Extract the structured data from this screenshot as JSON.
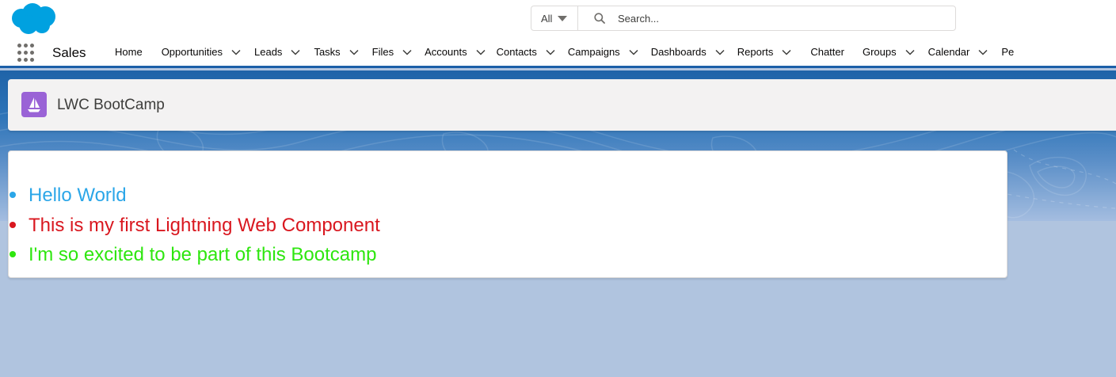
{
  "colors": {
    "brand_cloud": "#00a1e0",
    "nav_underline": "#1b5fa8",
    "page_icon_bg": "#9a63d6",
    "msg1": "#2ba6e8",
    "msg2": "#d9171f",
    "msg3": "#2ee60f"
  },
  "global_header": {
    "logo_icon": "salesforce-cloud-icon",
    "search": {
      "scope_label": "All",
      "placeholder": "Search..."
    }
  },
  "nav": {
    "launcher_icon": "app-launcher-grid-icon",
    "app_name": "Sales",
    "items": [
      {
        "label": "Home",
        "has_menu": false
      },
      {
        "label": "Opportunities",
        "has_menu": true
      },
      {
        "label": "Leads",
        "has_menu": true
      },
      {
        "label": "Tasks",
        "has_menu": true
      },
      {
        "label": "Files",
        "has_menu": true
      },
      {
        "label": "Accounts",
        "has_menu": true
      },
      {
        "label": "Contacts",
        "has_menu": true
      },
      {
        "label": "Campaigns",
        "has_menu": true
      },
      {
        "label": "Dashboards",
        "has_menu": true
      },
      {
        "label": "Reports",
        "has_menu": true
      },
      {
        "label": "Chatter",
        "has_menu": false
      },
      {
        "label": "Groups",
        "has_menu": true
      },
      {
        "label": "Calendar",
        "has_menu": true
      },
      {
        "label": "Pe",
        "has_menu": false
      }
    ]
  },
  "page_header": {
    "icon": "sailboat-icon",
    "title": "LWC BootCamp"
  },
  "card": {
    "messages": [
      {
        "text": "Hello World"
      },
      {
        "text": "This is my first Lightning Web Component"
      },
      {
        "text": "I'm so excited to be part of this Bootcamp"
      }
    ]
  }
}
